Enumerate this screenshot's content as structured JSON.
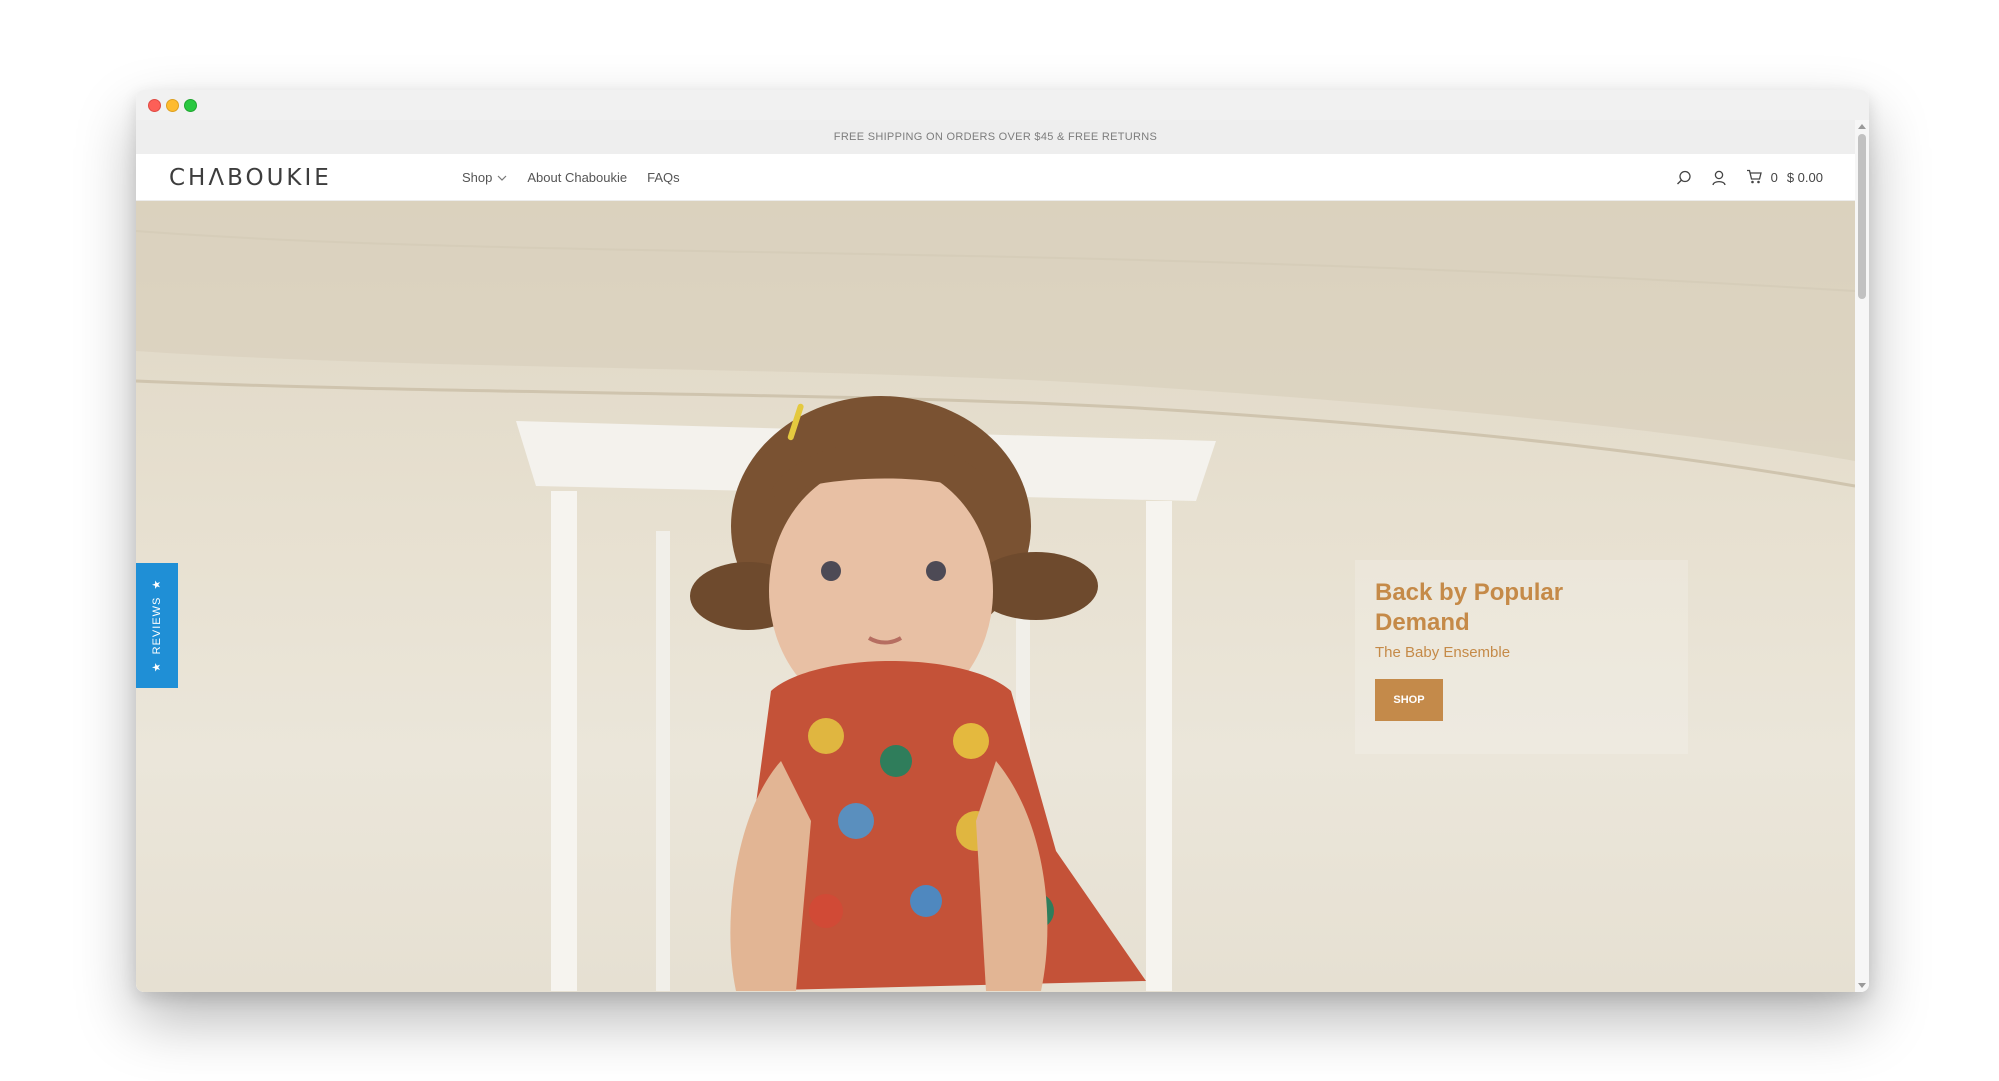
{
  "announcement": {
    "text": "FREE SHIPPING ON ORDERS OVER $45 & FREE RETURNS"
  },
  "header": {
    "logo": "CHΛBOUKIE",
    "nav": [
      {
        "label": "Shop",
        "has_dropdown": true
      },
      {
        "label": "About Chaboukie",
        "has_dropdown": false
      },
      {
        "label": "FAQs",
        "has_dropdown": false
      }
    ],
    "icons": [
      "search-icon",
      "account-icon",
      "cart-icon"
    ],
    "cart_count": "0",
    "cart_total": "$ 0.00"
  },
  "reviews_tab": {
    "label": "REVIEWS"
  },
  "hero": {
    "title": "Back by Popular Demand",
    "subtitle": "The Baby Ensemble",
    "button_label": "SHOP"
  },
  "colors": {
    "accent": "#c58a48",
    "reviews_tab": "#1f8fd6",
    "announcement_bg": "#eeeeee"
  }
}
